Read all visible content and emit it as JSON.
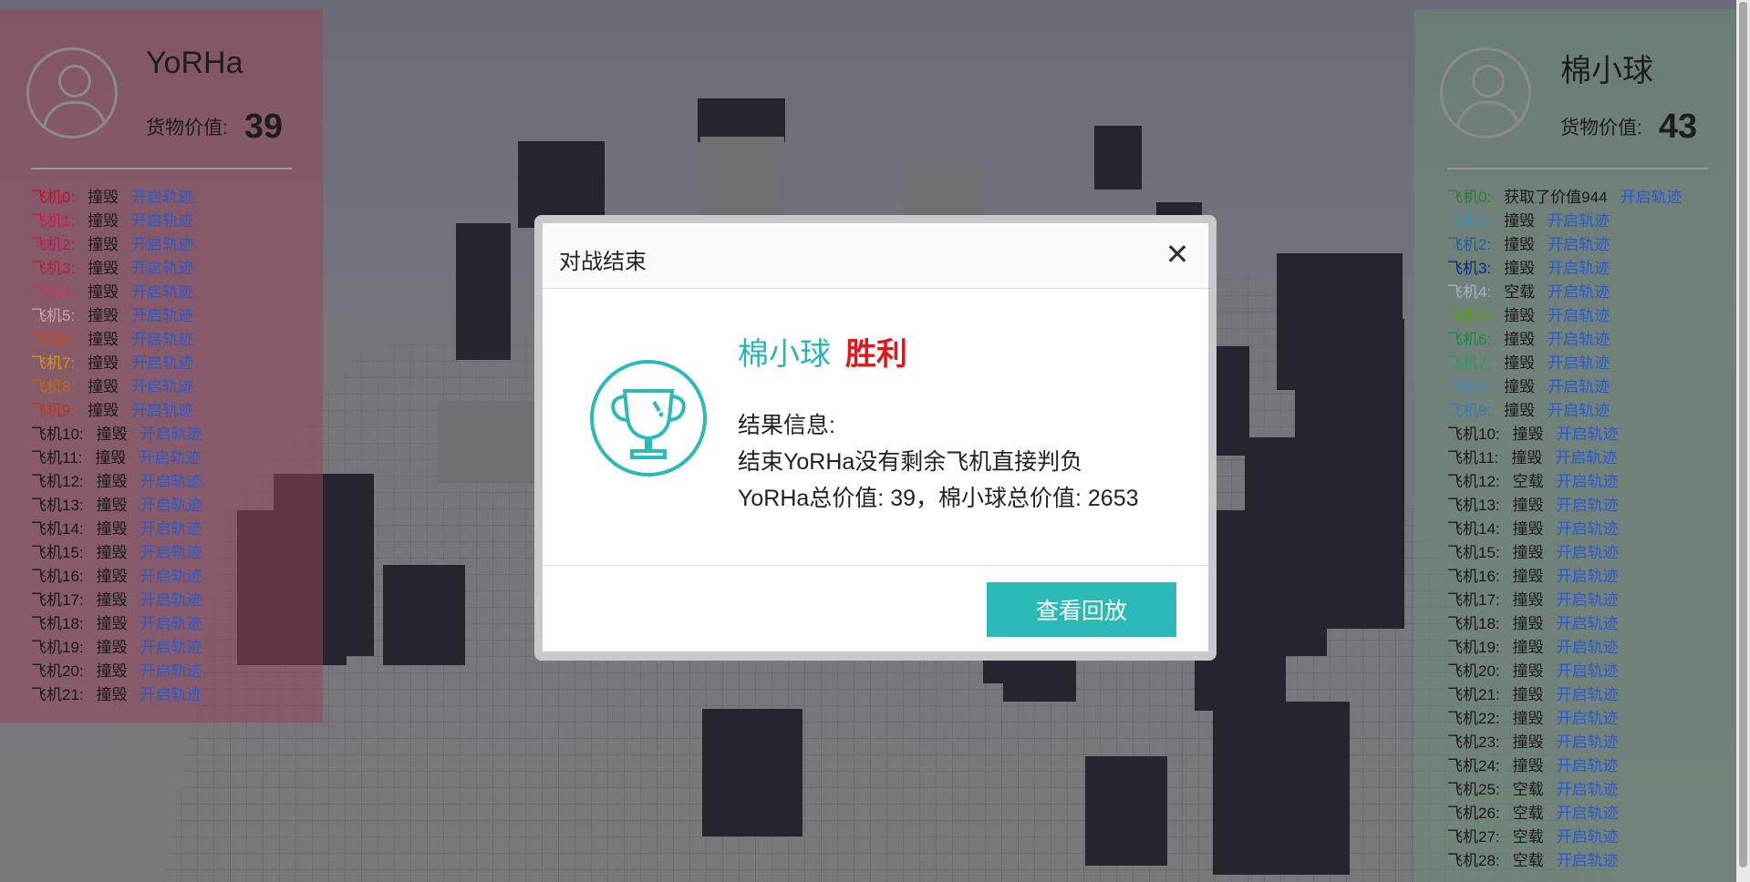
{
  "left_player": {
    "name": "YoRHa",
    "cargo_label": "货物价值:",
    "cargo_value": "39",
    "planes": [
      {
        "label": "飞机0:",
        "status": "撞毁",
        "link": "开启轨迹",
        "color": "#c8102e"
      },
      {
        "label": "飞机1:",
        "status": "撞毁",
        "link": "开启轨迹",
        "color": "#d4145a"
      },
      {
        "label": "飞机2:",
        "status": "撞毁",
        "link": "开启轨迹",
        "color": "#c2185b"
      },
      {
        "label": "飞机3:",
        "status": "撞毁",
        "link": "开启轨迹",
        "color": "#b71c3c"
      },
      {
        "label": "飞机4:",
        "status": "撞毁",
        "link": "开启轨迹",
        "color": "#c0395a"
      },
      {
        "label": "飞机5:",
        "status": "撞毁",
        "link": "开启轨迹",
        "color": "#d2a0a8"
      },
      {
        "label": "飞机6:",
        "status": "撞毁",
        "link": "开启轨迹",
        "color": "#cc4a1c"
      },
      {
        "label": "飞机7:",
        "status": "撞毁",
        "link": "开启轨迹",
        "color": "#c89a10"
      },
      {
        "label": "飞机8:",
        "status": "撞毁",
        "link": "开启轨迹",
        "color": "#c06a10"
      },
      {
        "label": "飞机9:",
        "status": "撞毁",
        "link": "开启轨迹",
        "color": "#c0381a"
      },
      {
        "label": "飞机10:",
        "status": "撞毁",
        "link": "开启轨迹",
        "color": "#1a1a1a"
      },
      {
        "label": "飞机11:",
        "status": "撞毁",
        "link": "开启轨迹",
        "color": "#1a1a1a"
      },
      {
        "label": "飞机12:",
        "status": "撞毁",
        "link": "开启轨迹",
        "color": "#1a1a1a"
      },
      {
        "label": "飞机13:",
        "status": "撞毁",
        "link": "开启轨迹",
        "color": "#1a1a1a"
      },
      {
        "label": "飞机14:",
        "status": "撞毁",
        "link": "开启轨迹",
        "color": "#1a1a1a"
      },
      {
        "label": "飞机15:",
        "status": "撞毁",
        "link": "开启轨迹",
        "color": "#1a1a1a"
      },
      {
        "label": "飞机16:",
        "status": "撞毁",
        "link": "开启轨迹",
        "color": "#1a1a1a"
      },
      {
        "label": "飞机17:",
        "status": "撞毁",
        "link": "开启轨迹",
        "color": "#1a1a1a"
      },
      {
        "label": "飞机18:",
        "status": "撞毁",
        "link": "开启轨迹",
        "color": "#1a1a1a"
      },
      {
        "label": "飞机19:",
        "status": "撞毁",
        "link": "开启轨迹",
        "color": "#1a1a1a"
      },
      {
        "label": "飞机20:",
        "status": "撞毁",
        "link": "开启轨迹",
        "color": "#1a1a1a"
      },
      {
        "label": "飞机21:",
        "status": "撞毁",
        "link": "开启轨迹",
        "color": "#1a1a1a"
      }
    ]
  },
  "right_player": {
    "name": "棉小球",
    "cargo_label": "货物价值:",
    "cargo_value": "43",
    "planes": [
      {
        "label": "飞机0:",
        "status": "获取了价值944",
        "link": "开启轨迹",
        "color": "#2e7d32"
      },
      {
        "label": "飞机1:",
        "status": "撞毁",
        "link": "开启轨迹",
        "color": "#3a8fb0"
      },
      {
        "label": "飞机2:",
        "status": "撞毁",
        "link": "开启轨迹",
        "color": "#1e5fa0"
      },
      {
        "label": "飞机3:",
        "status": "撞毁",
        "link": "开启轨迹",
        "color": "#0d2a7a"
      },
      {
        "label": "飞机4:",
        "status": "空载",
        "link": "开启轨迹",
        "color": "#a8b0c0"
      },
      {
        "label": "飞机5:",
        "status": "撞毁",
        "link": "开启轨迹",
        "color": "#56a010"
      },
      {
        "label": "飞机6:",
        "status": "撞毁",
        "link": "开启轨迹",
        "color": "#1a8a4a"
      },
      {
        "label": "飞机7:",
        "status": "撞毁",
        "link": "开启轨迹",
        "color": "#2a9a6a"
      },
      {
        "label": "飞机8:",
        "status": "撞毁",
        "link": "开启轨迹",
        "color": "#4a8ac0"
      },
      {
        "label": "飞机9:",
        "status": "撞毁",
        "link": "开启轨迹",
        "color": "#3a7ab8"
      },
      {
        "label": "飞机10:",
        "status": "撞毁",
        "link": "开启轨迹",
        "color": "#1a1a1a"
      },
      {
        "label": "飞机11:",
        "status": "撞毁",
        "link": "开启轨迹",
        "color": "#1a1a1a"
      },
      {
        "label": "飞机12:",
        "status": "空载",
        "link": "开启轨迹",
        "color": "#1a1a1a"
      },
      {
        "label": "飞机13:",
        "status": "撞毁",
        "link": "开启轨迹",
        "color": "#1a1a1a"
      },
      {
        "label": "飞机14:",
        "status": "撞毁",
        "link": "开启轨迹",
        "color": "#1a1a1a"
      },
      {
        "label": "飞机15:",
        "status": "撞毁",
        "link": "开启轨迹",
        "color": "#1a1a1a"
      },
      {
        "label": "飞机16:",
        "status": "撞毁",
        "link": "开启轨迹",
        "color": "#1a1a1a"
      },
      {
        "label": "飞机17:",
        "status": "撞毁",
        "link": "开启轨迹",
        "color": "#1a1a1a"
      },
      {
        "label": "飞机18:",
        "status": "撞毁",
        "link": "开启轨迹",
        "color": "#1a1a1a"
      },
      {
        "label": "飞机19:",
        "status": "撞毁",
        "link": "开启轨迹",
        "color": "#1a1a1a"
      },
      {
        "label": "飞机20:",
        "status": "撞毁",
        "link": "开启轨迹",
        "color": "#1a1a1a"
      },
      {
        "label": "飞机21:",
        "status": "撞毁",
        "link": "开启轨迹",
        "color": "#1a1a1a"
      },
      {
        "label": "飞机22:",
        "status": "撞毁",
        "link": "开启轨迹",
        "color": "#1a1a1a"
      },
      {
        "label": "飞机23:",
        "status": "撞毁",
        "link": "开启轨迹",
        "color": "#1a1a1a"
      },
      {
        "label": "飞机24:",
        "status": "撞毁",
        "link": "开启轨迹",
        "color": "#1a1a1a"
      },
      {
        "label": "飞机25:",
        "status": "空载",
        "link": "开启轨迹",
        "color": "#1a1a1a"
      },
      {
        "label": "飞机26:",
        "status": "空载",
        "link": "开启轨迹",
        "color": "#1a1a1a"
      },
      {
        "label": "飞机27:",
        "status": "空载",
        "link": "开启轨迹",
        "color": "#1a1a1a"
      },
      {
        "label": "飞机28:",
        "status": "空载",
        "link": "开启轨迹",
        "color": "#1a1a1a"
      }
    ]
  },
  "modal": {
    "title": "对战结束",
    "close_icon": "close-icon",
    "winner_name": "棉小球",
    "result": "胜利",
    "info_heading": "结果信息:",
    "info_line1": "结束YoRHa没有剩余飞机直接判负",
    "info_line2": "YoRHa总价值: 39，棉小球总价值: 2653",
    "replay_button": "查看回放",
    "trophy_icon": "trophy-icon",
    "accent_color": "#2bbab7",
    "win_color": "#e4161a"
  }
}
